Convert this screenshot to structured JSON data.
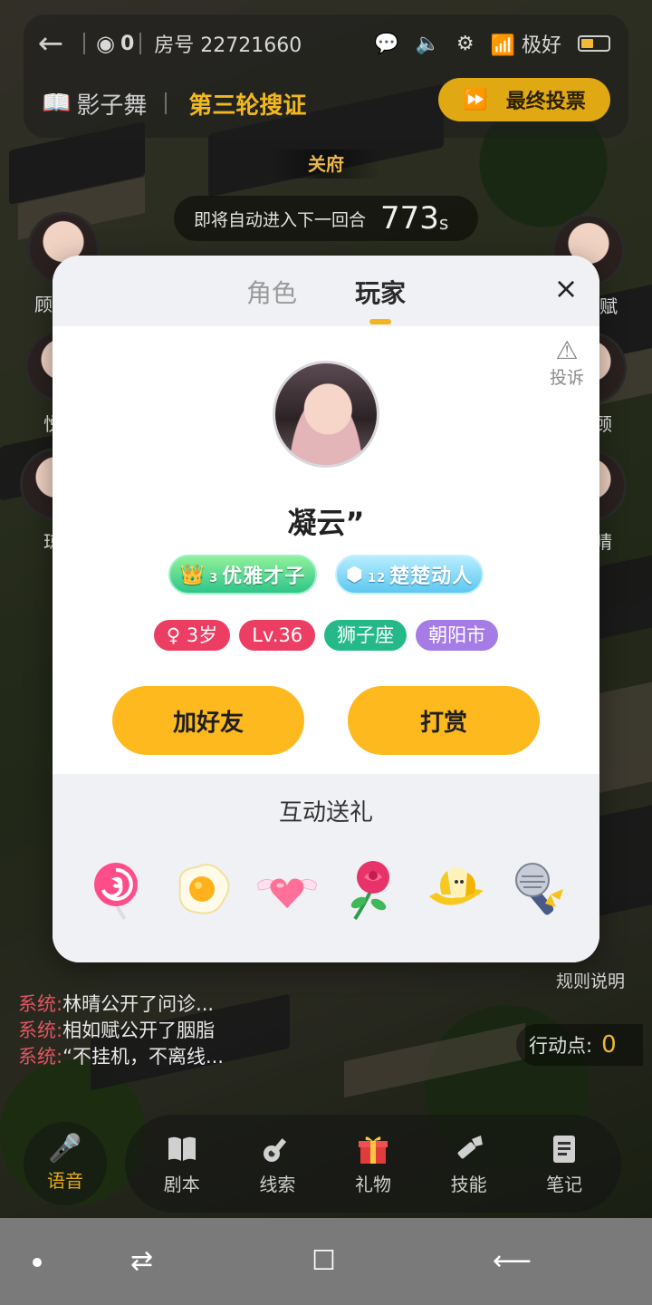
{
  "topbar": {
    "viewers": "0",
    "room_label": "房号 22721660",
    "network": "极好",
    "script_name": "影子舞",
    "round_title": "第三轮搜证",
    "final_vote": "最终投票"
  },
  "scene": {
    "location": "关府",
    "countdown_text": "即将自动进入下一回合",
    "countdown_value": "773",
    "countdown_unit": "s",
    "side_labels": [
      "顾",
      "悦",
      "琼",
      "赋",
      "顾",
      "晴"
    ]
  },
  "modal": {
    "tabs": [
      "角色",
      "玩家"
    ],
    "active_tab": "玩家",
    "close_symbol": "×",
    "report_label": "投诉",
    "nickname": "凝云”",
    "badges": [
      {
        "label": "优雅才子",
        "icon": "crown-icon",
        "level": "3"
      },
      {
        "label": "楚楚动人",
        "icon": "star-hexagon-icon",
        "level": "12"
      }
    ],
    "tags": [
      "3岁",
      "Lv.36",
      "狮子座",
      "朝阳市"
    ],
    "add_friend": "加好友",
    "tip": "打赏",
    "gift_title": "互动送礼",
    "gifts": [
      "lollipop",
      "fried-egg",
      "winged-heart",
      "rose",
      "banana",
      "microphone"
    ]
  },
  "chat": [
    {
      "prefix": "系统:",
      "text": "林晴公开了问诊..."
    },
    {
      "prefix": "系统:",
      "text": "相如赋公开了胭脂"
    },
    {
      "prefix": "系统:",
      "text": "“不挂机，不离线..."
    }
  ],
  "rules_label": "规则说明",
  "action_points": {
    "label": "行动点:",
    "value": "0"
  },
  "dock": {
    "voice": "语音",
    "items": [
      "剧本",
      "线索",
      "礼物",
      "技能",
      "笔记"
    ]
  },
  "colors": {
    "accent": "#fdb91d",
    "system": "#e25563",
    "modal_bg": "#ffffff"
  }
}
